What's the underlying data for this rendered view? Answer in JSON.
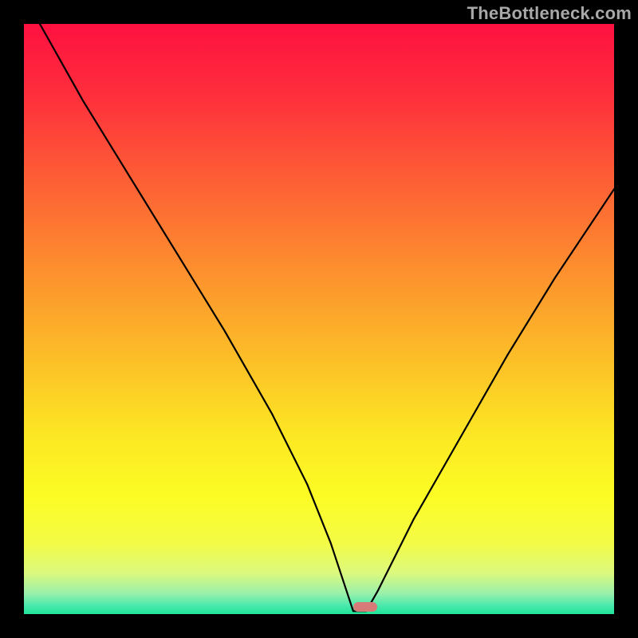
{
  "watermark": "TheBottleneck.com",
  "marker": {
    "x_pct": 55.8,
    "width_pct": 4.0,
    "bottom_offset_pct": 0.4
  },
  "colors": {
    "curve_stroke": "#000000",
    "background": "#000000",
    "marker": "#d67b78"
  },
  "gradient_stops": [
    {
      "offset": 0,
      "color": "#fe1140"
    },
    {
      "offset": 0.12,
      "color": "#fe2e3c"
    },
    {
      "offset": 0.25,
      "color": "#fd5a36"
    },
    {
      "offset": 0.4,
      "color": "#fd8a2f"
    },
    {
      "offset": 0.55,
      "color": "#fcb928"
    },
    {
      "offset": 0.7,
      "color": "#fce823"
    },
    {
      "offset": 0.8,
      "color": "#fcfc24"
    },
    {
      "offset": 0.88,
      "color": "#f3fb45"
    },
    {
      "offset": 0.93,
      "color": "#dcf97d"
    },
    {
      "offset": 0.965,
      "color": "#9af0ab"
    },
    {
      "offset": 0.985,
      "color": "#4de9ad"
    },
    {
      "offset": 1.0,
      "color": "#1de598"
    }
  ],
  "chart_data": {
    "type": "line",
    "title": "",
    "xlabel": "",
    "ylabel": "",
    "xlim": [
      0,
      100
    ],
    "ylim": [
      0,
      100
    ],
    "series": [
      {
        "name": "bottleneck-curve",
        "x": [
          2.7,
          10,
          18,
          26,
          34,
          42,
          48,
          52,
          55.8,
          58.0,
          60,
          66,
          74,
          82,
          90,
          100
        ],
        "y": [
          100,
          87,
          74,
          61,
          48,
          34,
          22,
          12,
          0.5,
          0.5,
          4,
          16,
          30,
          44,
          57,
          72
        ]
      }
    ],
    "marker_point": {
      "x": 57.5,
      "y": 0.5
    },
    "annotations": []
  }
}
